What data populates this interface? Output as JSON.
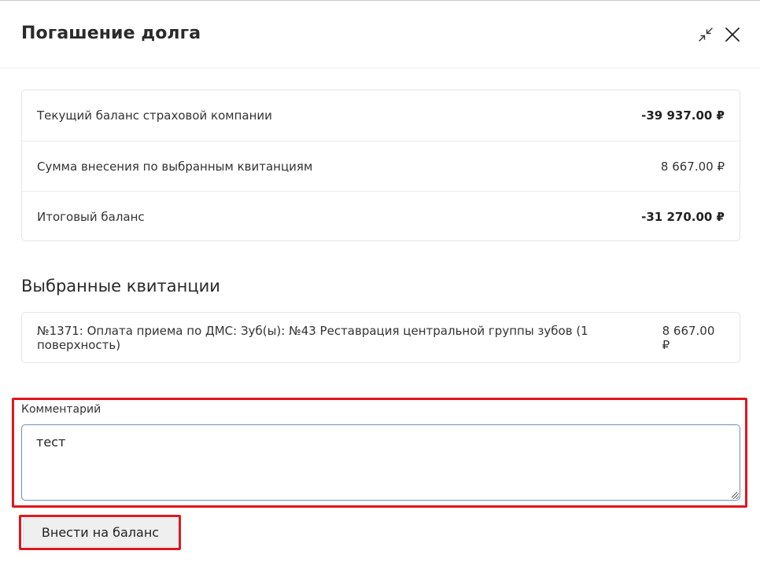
{
  "dialog": {
    "title": "Погашение долга"
  },
  "summary": {
    "rows": [
      {
        "label": "Текущий баланс страховой компании",
        "value": "-39 937.00 ₽"
      },
      {
        "label": "Сумма внесения по выбранным квитанциям",
        "value": "8 667.00 ₽"
      },
      {
        "label": "Итоговый баланс",
        "value": "-31 270.00 ₽"
      }
    ]
  },
  "receipts": {
    "title": "Выбранные квитанции",
    "items": [
      {
        "label": "№1371: Оплата приема по ДМС: Зуб(ы): №43 Реставрация центральной группы зубов (1 поверхность)",
        "value": "8 667.00 ₽"
      }
    ]
  },
  "comment": {
    "label": "Комментарий",
    "value": "тест"
  },
  "submit": {
    "label": "Внести на баланс"
  },
  "colors": {
    "highlight": "#e0161e",
    "input_border": "#6c8fb8"
  }
}
